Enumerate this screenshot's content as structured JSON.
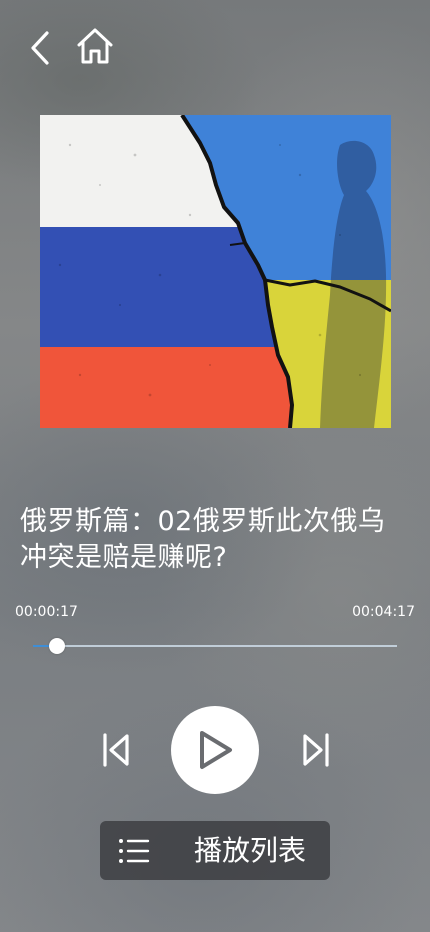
{
  "header": {
    "back_icon": "chevron-left-icon",
    "home_icon": "home-icon"
  },
  "cover": {
    "description_icon": "album-cover-image",
    "colors": {
      "russia_white": "#f2f2f0",
      "russia_blue": "#3350b4",
      "russia_red": "#f0553a",
      "ukraine_blue": "#3f82d8",
      "ukraine_yellow": "#d9d43a"
    }
  },
  "track": {
    "title": "俄罗斯篇：02俄罗斯此次俄乌冲突是赔是赚呢?"
  },
  "player": {
    "current_time": "00:00:17",
    "total_time": "00:04:17",
    "progress_fraction": 0.066,
    "prev_icon": "skip-previous-icon",
    "play_icon": "play-icon",
    "next_icon": "skip-next-icon"
  },
  "playlist": {
    "icon": "list-icon",
    "label": "播放列表"
  },
  "colors": {
    "progress_track": "#cddae8",
    "progress_fill": "#3f8ed6",
    "play_button_bg": "#ffffff",
    "play_icon": "#6a6c70",
    "playlist_button_bg": "#3a3c3f"
  }
}
